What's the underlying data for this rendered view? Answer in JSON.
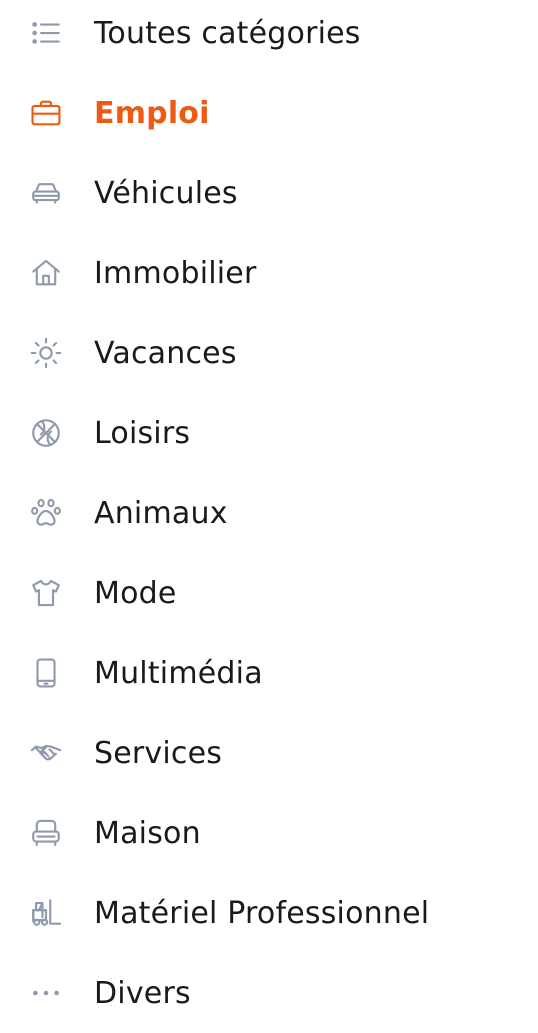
{
  "category_menu": {
    "active_color": "#ec5a13",
    "icon_color": "#8e9aab",
    "text_color": "#1a1a1a",
    "items": [
      {
        "label": "Toutes catégories",
        "icon": "list-icon",
        "active": false
      },
      {
        "label": "Emploi",
        "icon": "briefcase-icon",
        "active": true
      },
      {
        "label": "Véhicules",
        "icon": "car-icon",
        "active": false
      },
      {
        "label": "Immobilier",
        "icon": "house-icon",
        "active": false
      },
      {
        "label": "Vacances",
        "icon": "sun-icon",
        "active": false
      },
      {
        "label": "Loisirs",
        "icon": "ball-icon",
        "active": false
      },
      {
        "label": "Animaux",
        "icon": "paw-icon",
        "active": false
      },
      {
        "label": "Mode",
        "icon": "tshirt-icon",
        "active": false
      },
      {
        "label": "Multimédia",
        "icon": "smartphone-icon",
        "active": false
      },
      {
        "label": "Services",
        "icon": "handshake-icon",
        "active": false
      },
      {
        "label": "Maison",
        "icon": "armchair-icon",
        "active": false
      },
      {
        "label": "Matériel Professionnel",
        "icon": "forklift-icon",
        "active": false
      },
      {
        "label": "Divers",
        "icon": "more-dots-icon",
        "active": false
      }
    ]
  }
}
